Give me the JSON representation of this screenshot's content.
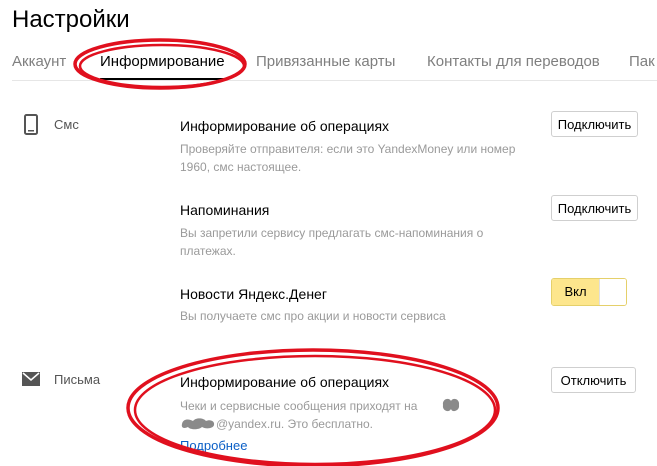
{
  "page_title": "Настройки",
  "tabs": [
    {
      "label": "Аккаунт"
    },
    {
      "label": "Информирование",
      "active": true
    },
    {
      "label": "Привязанные карты"
    },
    {
      "label": "Контакты для переводов"
    },
    {
      "label": "Пак"
    }
  ],
  "sms": {
    "label": "Смс",
    "icon": "phone-icon",
    "items": [
      {
        "title": "Информирование об операциях",
        "description": "Проверяйте отправителя: если это YandexMoney или номер 1960, смс настоящее.",
        "button": "Подключить"
      },
      {
        "title": "Напоминания",
        "description": "Вы запретили сервису предлагать смс-напоминания о платежах.",
        "button": "Подключить"
      },
      {
        "title": "Новости Яндекс.Денег",
        "description": "Вы получаете смс про акции и новости сервиса",
        "toggle": "Вкл"
      }
    ]
  },
  "mail": {
    "label": "Письма",
    "icon": "envelope-icon",
    "items": [
      {
        "title": "Информирование об операциях",
        "description_line1": "Чеки и сервисные сообщения приходят на",
        "description_line2": "@yandex.ru. Это бесплатно.",
        "button": "Отключить",
        "link": "Подробнее"
      }
    ]
  },
  "colors": {
    "annotation": "#e0101e",
    "toggle_on": "#fde68d",
    "link": "#0b5fc6"
  }
}
